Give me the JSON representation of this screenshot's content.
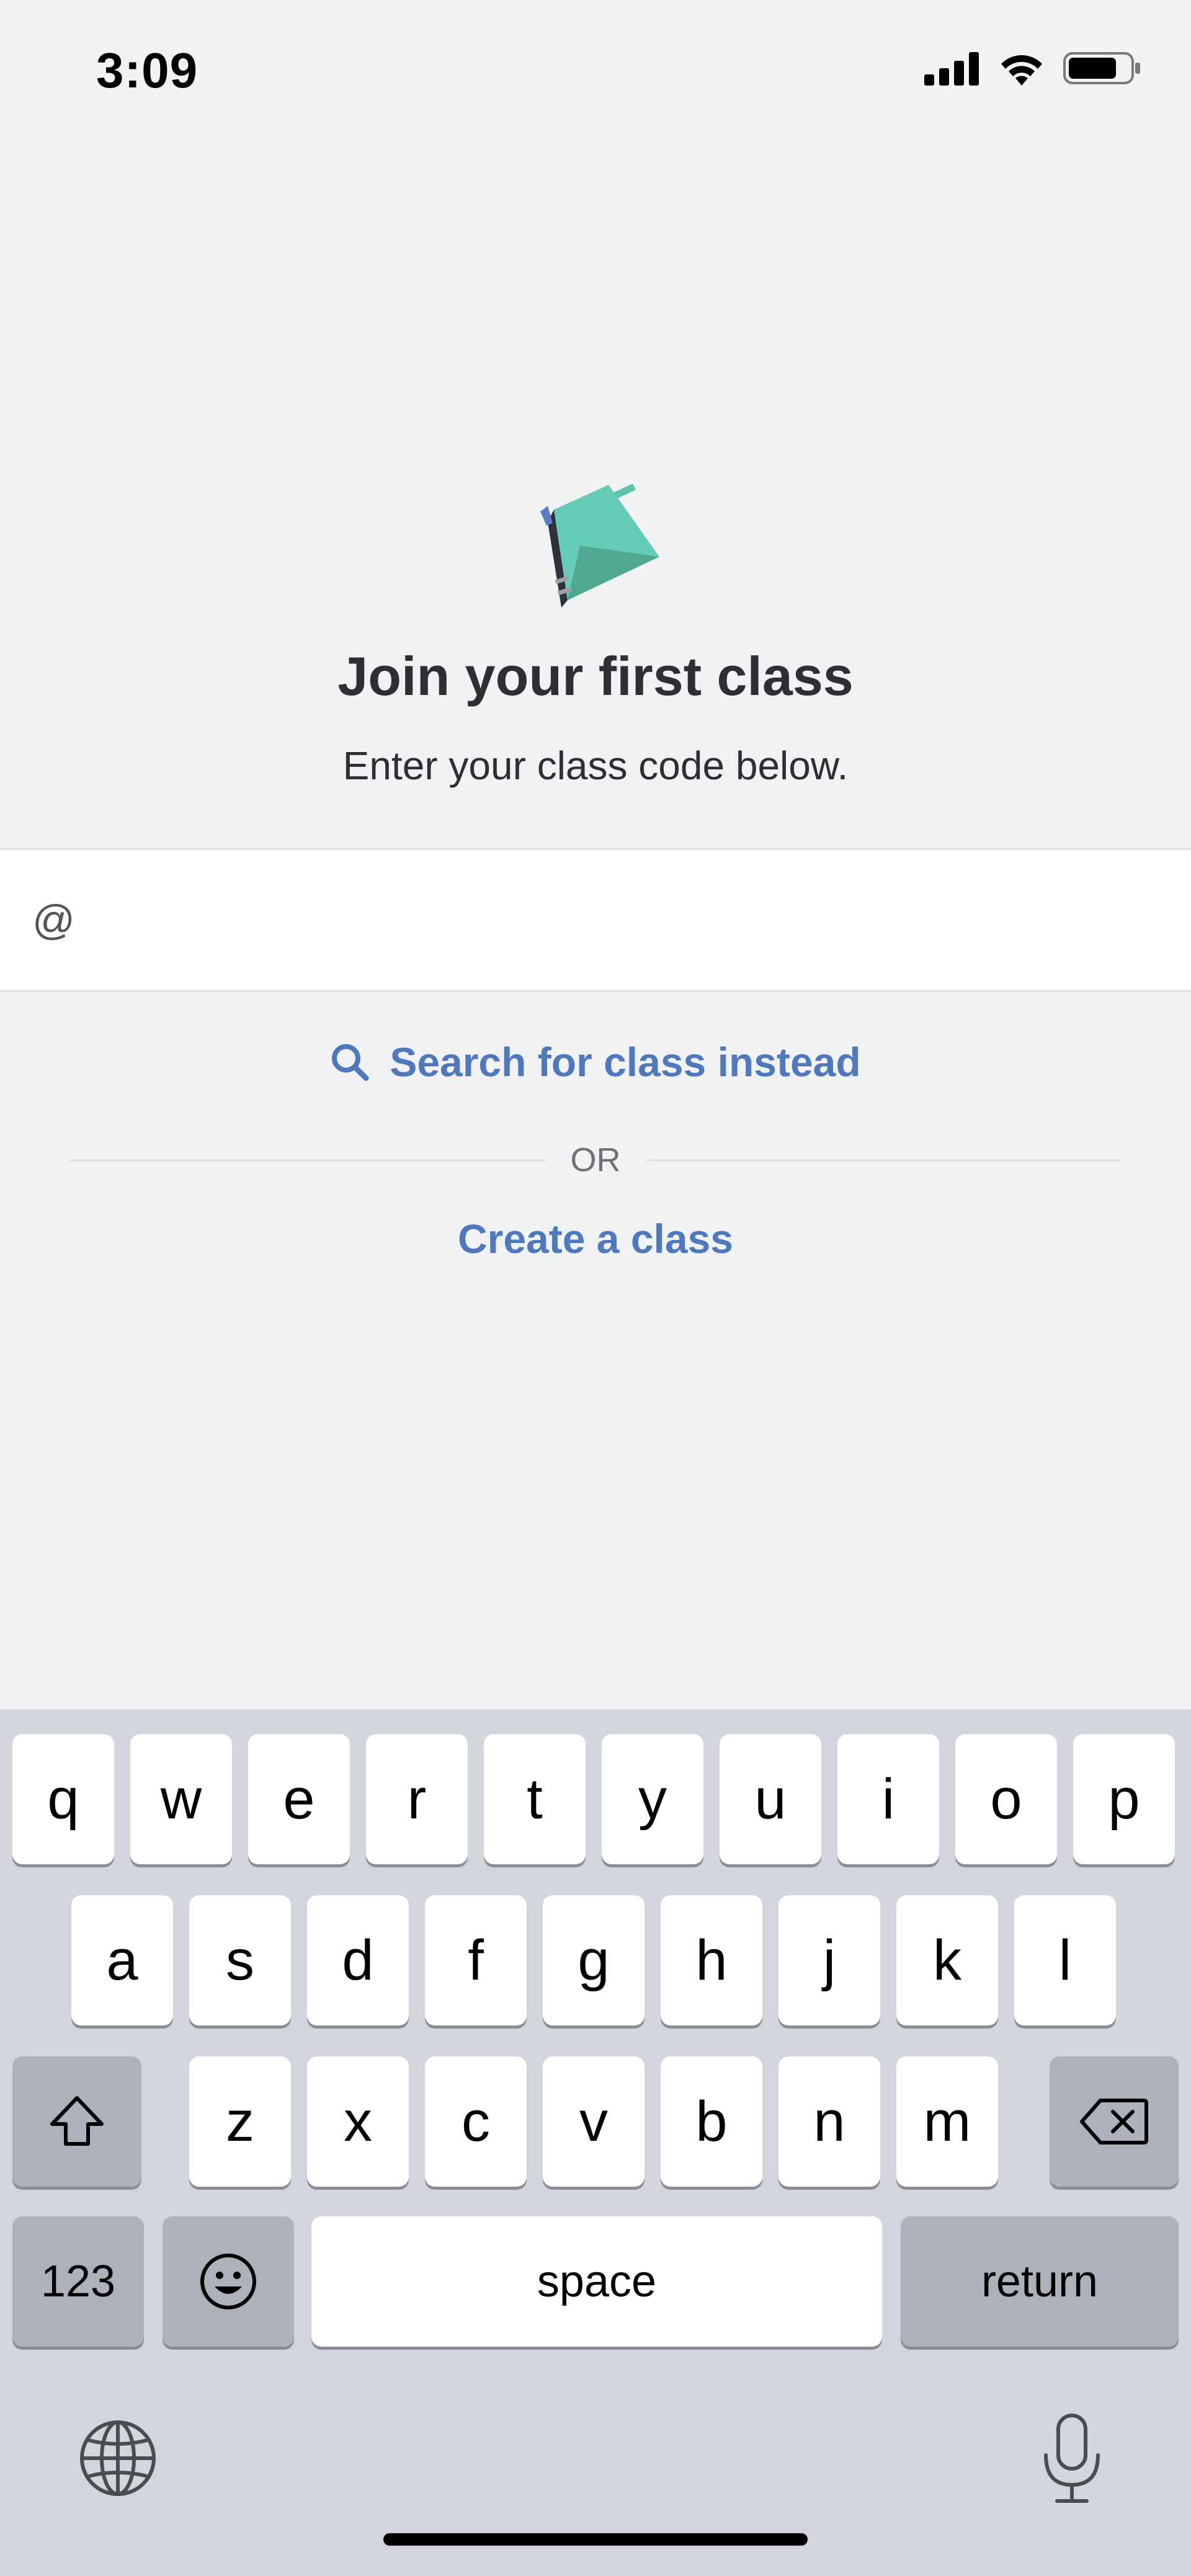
{
  "status_bar": {
    "time": "3:09"
  },
  "hero": {
    "title": "Join your first class",
    "subtitle": "Enter your class code below."
  },
  "code_field": {
    "prefix": "@",
    "value": "",
    "placeholder": ""
  },
  "links": {
    "search_label": "Search for class instead",
    "or_label": "OR",
    "create_label": "Create a class"
  },
  "colors": {
    "accent": "#4f78bd",
    "book_teal": "#5fc2ad",
    "book_dark": "#2f3138",
    "background": "#f1f2f4"
  },
  "keyboard": {
    "row1": [
      "q",
      "w",
      "e",
      "r",
      "t",
      "y",
      "u",
      "i",
      "o",
      "p"
    ],
    "row2": [
      "a",
      "s",
      "d",
      "f",
      "g",
      "h",
      "j",
      "k",
      "l"
    ],
    "row3": [
      "z",
      "x",
      "c",
      "v",
      "b",
      "n",
      "m"
    ],
    "numbers_label": "123",
    "space_label": "space",
    "return_label": "return",
    "icons": [
      "shift-icon",
      "delete-icon",
      "emoji-icon",
      "globe-icon",
      "microphone-icon"
    ]
  }
}
